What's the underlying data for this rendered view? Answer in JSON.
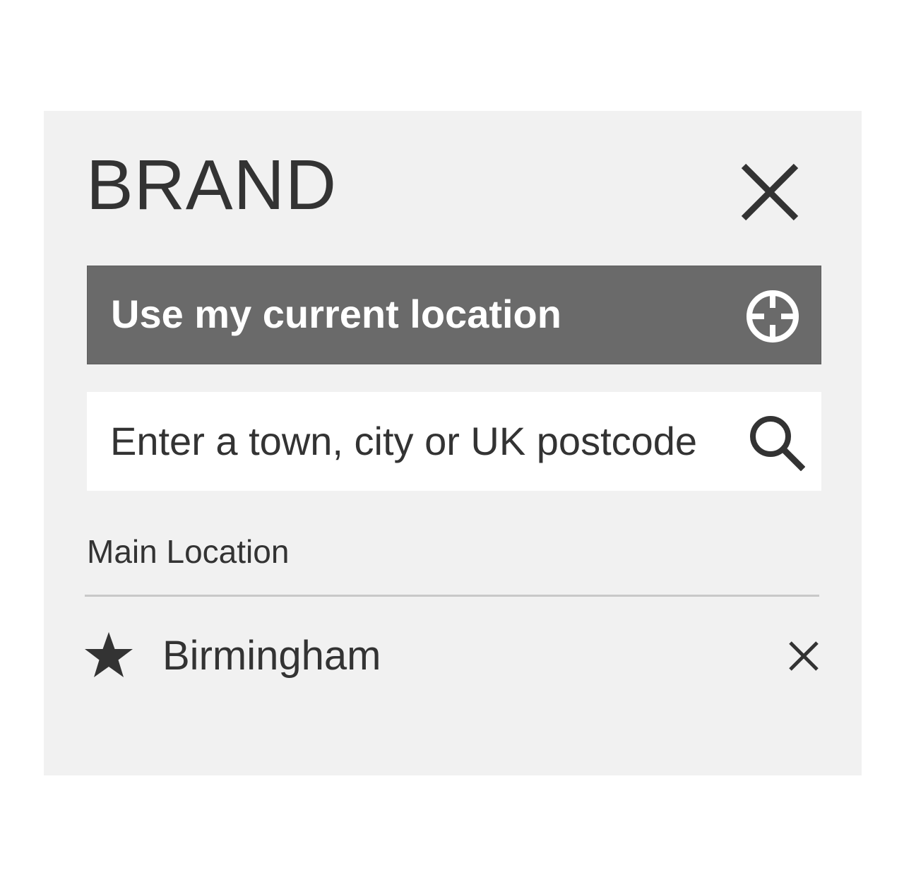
{
  "header": {
    "brand": "BRAND",
    "close_icon": "close-icon"
  },
  "locate": {
    "label": "Use my current location",
    "icon": "crosshair-icon"
  },
  "search": {
    "value": "",
    "placeholder": "Enter a town, city or UK postcode",
    "icon": "search-icon"
  },
  "locations": {
    "section_label": "Main Location",
    "items": [
      {
        "name": "Birmingham",
        "icon": "star-icon",
        "remove_icon": "close-icon"
      }
    ]
  },
  "colors": {
    "panel_bg": "#f1f1f1",
    "button_bg": "#6a6a6a",
    "text": "#333333",
    "divider": "#c8c8c8"
  }
}
